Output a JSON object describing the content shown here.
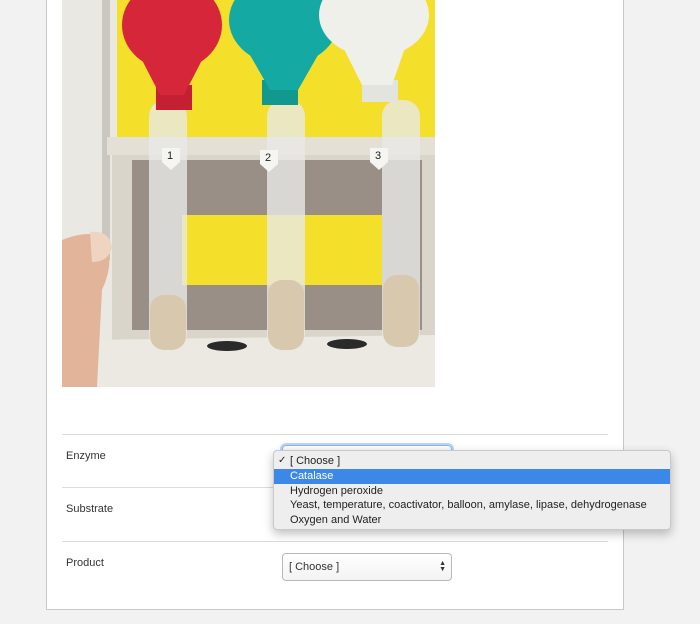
{
  "form": {
    "rows": [
      {
        "label": "Enzyme"
      },
      {
        "label": "Substrate"
      },
      {
        "label": "Product",
        "value": "[ Choose ]"
      }
    ],
    "dropdown": {
      "options": [
        {
          "label": "[ Choose ]",
          "checked": true
        },
        {
          "label": "Catalase",
          "highlighted": true
        },
        {
          "label": "Hydrogen peroxide"
        },
        {
          "label": "Yeast, temperature, coactivator, balloon, amylase, lipase, dehydrogenase"
        },
        {
          "label": "Oxygen and Water"
        }
      ],
      "check_mark": "✓"
    }
  },
  "photo": {
    "tube_labels": [
      "1",
      "2",
      "3"
    ],
    "balloon_colors": [
      "#d5263a",
      "#14a9a2",
      "#f0f0ea"
    ],
    "background_color": "#f4df2a"
  },
  "colors": {
    "highlight": "#3b88e8",
    "focus_ring": "#8cb7ef"
  },
  "icons": {
    "select_arrows": "updown-arrows-icon"
  }
}
